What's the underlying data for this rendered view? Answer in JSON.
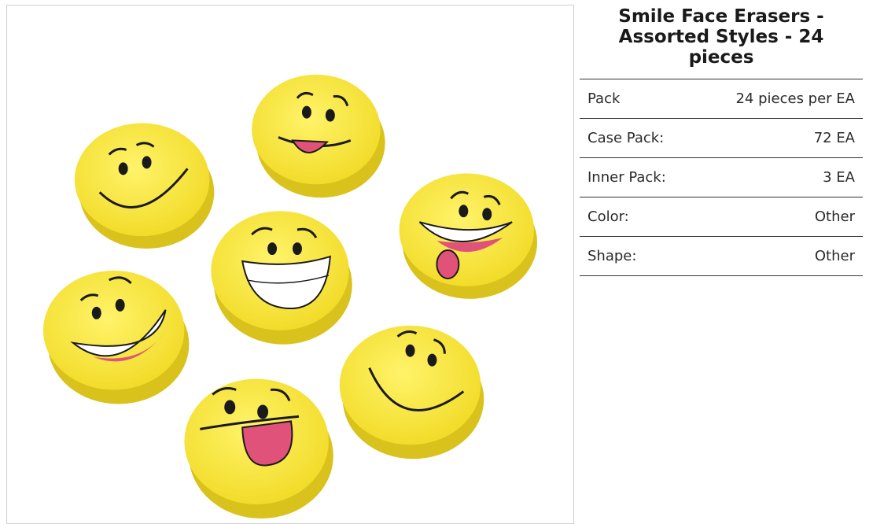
{
  "product": {
    "title": "Smile Face Erasers - Assorted Styles - 24 pieces",
    "image_alt_icon": "smiley-erasers-photo",
    "colors": {
      "eraser_yellow": "#f6e23a",
      "eraser_edge": "#d9c21c",
      "outline": "#1a1a1a",
      "mouth_pink": "#e0527a"
    }
  },
  "specs": [
    {
      "label": "Pack",
      "value": "24 pieces per EA"
    },
    {
      "label": "Case Pack:",
      "value": "72 EA"
    },
    {
      "label": "Inner Pack:",
      "value": "3 EA"
    },
    {
      "label": "Color:",
      "value": "Other"
    },
    {
      "label": "Shape:",
      "value": "Other"
    }
  ]
}
